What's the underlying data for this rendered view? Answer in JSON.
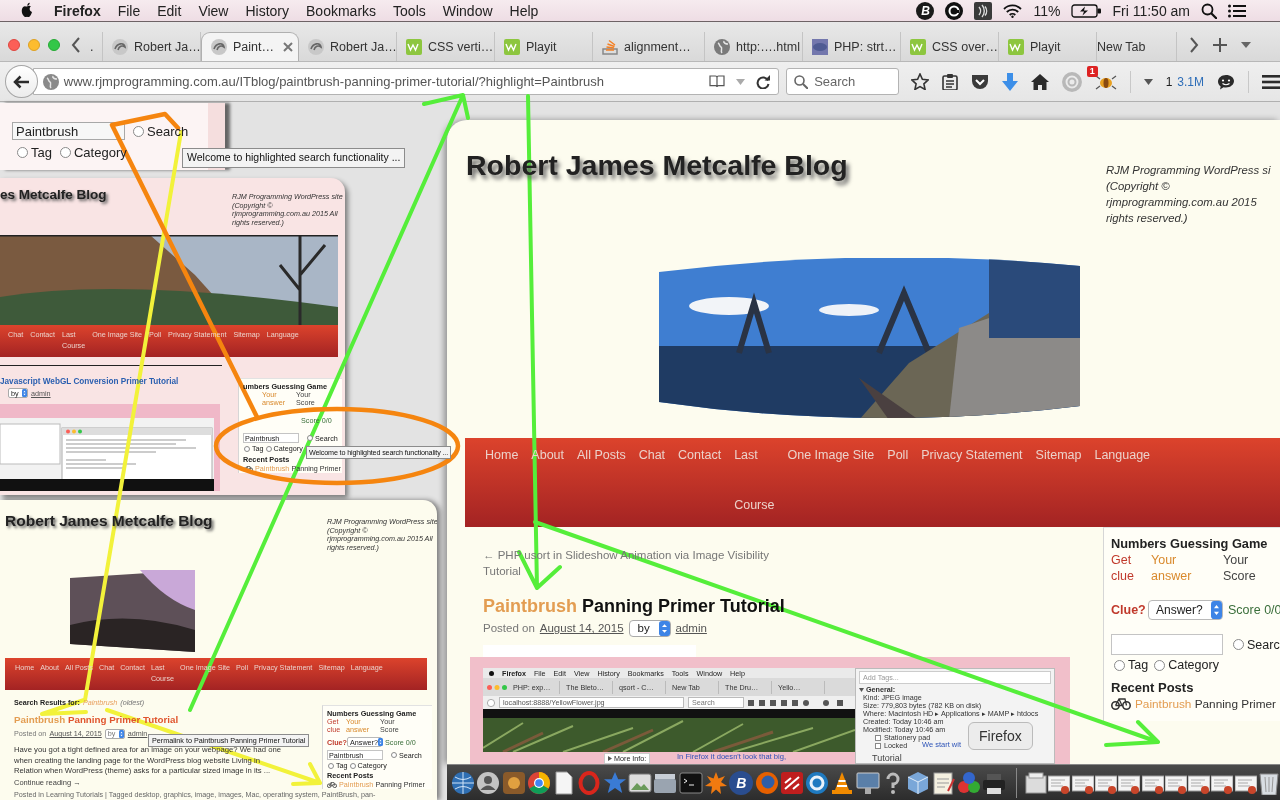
{
  "menu_bar": {
    "app": "Firefox",
    "items": [
      "File",
      "Edit",
      "View",
      "History",
      "Bookmarks",
      "Tools",
      "Window",
      "Help"
    ],
    "status_letter": "B",
    "battery": "11%",
    "clock": "Fri 11:50 am"
  },
  "tabs": [
    {
      "label": ".",
      "kind": "stub",
      "selected": false
    },
    {
      "label": "Robert Ja…",
      "kind": "swirl",
      "selected": false
    },
    {
      "label": "Paint…",
      "kind": "swirl",
      "selected": true
    },
    {
      "label": "Robert Ja…",
      "kind": "swirl",
      "selected": false
    },
    {
      "label": "CSS verti…",
      "kind": "w3",
      "selected": false
    },
    {
      "label": "Playit",
      "kind": "w3",
      "selected": false
    },
    {
      "label": "alignment…",
      "kind": "stack",
      "selected": false
    },
    {
      "label": "http:….html",
      "kind": "globe",
      "selected": false
    },
    {
      "label": "PHP: strt…",
      "kind": "php",
      "selected": false
    },
    {
      "label": "CSS over…",
      "kind": "w3",
      "selected": false
    },
    {
      "label": "Playit",
      "kind": "w3",
      "selected": false
    },
    {
      "label": "New Tab",
      "kind": "blank",
      "selected": false
    }
  ],
  "address_bar": {
    "url": "www.rjmprogramming.com.au/ITblog/paintbrush-panning-primer-tutorial/?highlight=Paintbrush",
    "search_placeholder": "Search",
    "badge": "1",
    "count": "1",
    "size": "3.1M"
  },
  "search_snippet": {
    "value": "Paintbrush",
    "options": [
      {
        "label": "Search",
        "selected": false
      },
      {
        "label": "Tag",
        "selected": false
      },
      {
        "label": "Category",
        "selected": false
      }
    ],
    "tooltip": "Welcome to highlighted search functionality ..."
  },
  "snapshot_webgl": {
    "title": "es Metcalfe Blog",
    "tagline": [
      "RJM Programming WordPress site",
      "(Copyright ©",
      "rjmprogramming.com.au 2015 All",
      "rights reserved.)"
    ],
    "nav": [
      "Chat",
      "Contact",
      "Last\nCourse",
      "One Image Site",
      "Poll",
      "Privacy Statement",
      "Sitemap",
      "Language"
    ],
    "post_title": "Javascript WebGL Conversion Primer Tutorial",
    "by": "by",
    "author": "admin",
    "sidebar": {
      "title": "umbers Guessing Game",
      "columns": [
        {
          "label": "Your answer",
          "kind": "answer"
        },
        {
          "label": "Your Score",
          "kind": "score"
        }
      ],
      "score": "Score 0/0",
      "search_value": "Paintbrush",
      "options": [
        {
          "label": "Search",
          "selected": false
        },
        {
          "label": "Tag",
          "selected": false
        },
        {
          "label": "Category",
          "selected": false
        }
      ],
      "recent_title": "Recent Posts",
      "recent": [
        {
          "highlight": "Paintbrush",
          "rest": "Panning Primer"
        }
      ]
    },
    "tooltip": "Welcome to highlighted search functionality ..."
  },
  "snapshot_search": {
    "title": "Robert James Metcalfe Blog",
    "tagline": [
      "RJM Programming WordPress site",
      "(Copyright ©",
      "rjmprogramming.com.au 2015 All",
      "rights reserved.)"
    ],
    "nav": [
      "Home",
      "About",
      "All Posts",
      "Chat",
      "Contact",
      "Last\nCourse",
      "One Image Site",
      "Poll",
      "Privacy Statement",
      "Sitemap",
      "Language"
    ],
    "results_label": "Search Results for:",
    "results_term": "Paintbrush",
    "results_order": "(oldest)",
    "post_title": {
      "highlight": "Paintbrush",
      "rest": "Panning Primer Tutorial"
    },
    "posted_on": "Posted on",
    "date": "August 14, 2015",
    "by": "by",
    "author": "admin",
    "permalink_tooltip": "Permalink to Paintbrush Panning Primer Tutorial",
    "excerpt": [
      "Have you got a tight defined area for an image on your webpage? We had one",
      "when creating the landing page for the WordPress blog website Living in",
      "Relation when WordPress (theme) asks for a particular sized image in its ..."
    ],
    "continue": "Continue reading →",
    "footer": "Posted in Learning Tutorials | Tagged desktop, graphics, image, images, Mac, operating system, PaintBrush, pan-",
    "sidebar": {
      "title": "Numbers Guessing Game",
      "columns": [
        {
          "label": "Get clue",
          "kind": "clue"
        },
        {
          "label": "Your answer",
          "kind": "answer"
        },
        {
          "label": "Your Score",
          "kind": "score"
        }
      ],
      "clue_label": "Clue?",
      "answer": "Answer?",
      "score": "Score 0/0",
      "search_value": "Paintbrush",
      "options": [
        {
          "label": "Search",
          "selected": false
        },
        {
          "label": "Tag",
          "selected": false
        },
        {
          "label": "Category",
          "selected": false
        }
      ],
      "recent_title": "Recent Posts",
      "recent": [
        {
          "highlight": "Paintbrush",
          "rest": "Panning Primer"
        }
      ]
    }
  },
  "blog_page": {
    "title": "Robert James Metcalfe Blog",
    "tagline": [
      "RJM Programming WordPress si",
      "(Copyright ©",
      "rjmprogramming.com.au 2015",
      "rights reserved.)"
    ],
    "nav": [
      "Home",
      "About",
      "All Posts",
      "Chat",
      "Contact",
      "Last\nCourse",
      "One Image Site",
      "Poll",
      "Privacy Statement",
      "Sitemap",
      "Language"
    ],
    "prev_link": [
      "← PHP usort in Slideshow Animation via Image Visibility",
      "Tutorial"
    ],
    "post_title": {
      "highlight": "Paintbrush",
      "rest": "Panning Primer Tutorial"
    },
    "posted_on": "Posted on",
    "date": "August 14, 2015",
    "by": "by",
    "author": "admin",
    "post_screenshot": {
      "menu": [
        "Firefox",
        "File",
        "Edit",
        "View",
        "History",
        "Bookmarks",
        "Tools",
        "Window",
        "Help"
      ],
      "tabs": [
        "PHP: exp…",
        "The Bleto…",
        "qsort - C…",
        "New Tab",
        "The Dru…",
        "Yello…"
      ],
      "url": "localhost:8888/YellowFlower.jpg",
      "search_placeholder": "Search",
      "tags_placeholder": "Add Tags...",
      "section": "General:",
      "info": [
        "Kind: JPEG image",
        "Size: 779,803 bytes (782 KB on disk)",
        "Where: Macintosh HD ▸ Applications ▸ MAMP ▸ htdocs",
        "Created: Today 10:46 am",
        "Modified: Today 10:46 am"
      ],
      "checks": [
        {
          "label": "Stationery pad",
          "checked": false
        },
        {
          "label": "Locked",
          "checked": false
        }
      ],
      "side_text": "We start wit",
      "more_info": "More Info:",
      "caption": "In Firefox it doesn't look that big,",
      "side_heading": "Tutorial"
    },
    "sidebar": {
      "title": "Numbers Guessing Game",
      "columns": [
        {
          "label": "Get clue",
          "kind": "clue"
        },
        {
          "label": "Your answer",
          "kind": "answer"
        },
        {
          "label": "Your Score",
          "kind": "score"
        }
      ],
      "clue_label": "Clue?",
      "answer": "Answer?",
      "score": "Score 0/0",
      "options": [
        {
          "label": "Searc",
          "selected": false
        },
        {
          "label": "Tag",
          "selected": false
        },
        {
          "label": "Category",
          "selected": false
        }
      ],
      "recent_title": "Recent Posts",
      "recent": [
        {
          "highlight": "Paintbrush",
          "rest": "Panning Primer"
        }
      ]
    }
  },
  "dock": {
    "tooltip": "Firefox",
    "letter": "B"
  }
}
